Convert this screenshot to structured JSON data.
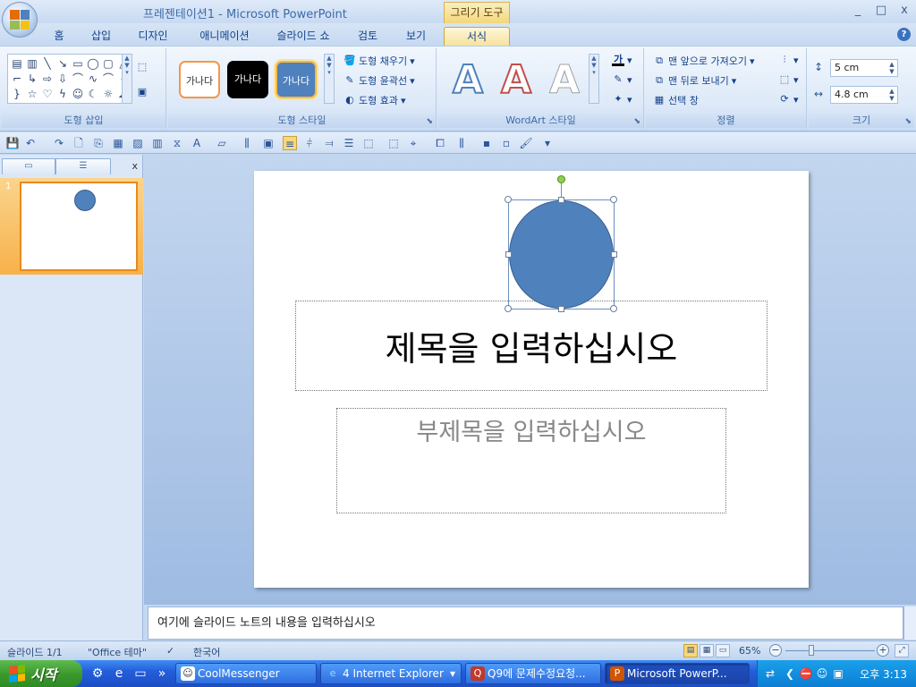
{
  "window": {
    "title": "프레젠테이션1 - Microsoft PowerPoint",
    "context_tab_title": "그리기 도구",
    "controls": [
      "_",
      "□",
      "x"
    ]
  },
  "tabs": [
    "홈",
    "삽입",
    "디자인",
    "애니메이션",
    "슬라이드 쇼",
    "검토",
    "보기",
    "서식"
  ],
  "active_tab": "서식",
  "ribbon": {
    "groups": {
      "insert_shapes": "도형 삽입",
      "shape_styles": "도형 스타일",
      "wordart_styles": "WordArt 스타일",
      "arrange": "정렬",
      "size": "크기"
    },
    "style_thumbs": [
      "가나다",
      "가나다",
      "가나다"
    ],
    "shape_fill": "도형 채우기",
    "shape_outline": "도형 윤곽선",
    "shape_effects": "도형 효과",
    "wordart_letters": [
      "A",
      "A",
      "A"
    ],
    "text_fill_glyph": "가",
    "bring_to_front": "맨 앞으로 가져오기",
    "send_to_back": "맨 뒤로 보내기",
    "selection_pane": "선택 창",
    "height_value": "5 cm",
    "width_value": "4.8 cm"
  },
  "slide": {
    "title_placeholder": "제목을 입력하십시오",
    "subtitle_placeholder": "부제목을 입력하십시오",
    "shape_color": "#4f81bd",
    "shape_outline_color": "#385d8a"
  },
  "thumbnail": {
    "number": "1"
  },
  "notes": {
    "placeholder": "여기에 슬라이드 노트의 내용을 입력하십시오"
  },
  "status": {
    "slide_index": "슬라이드 1/1",
    "theme": "\"Office 테마\"",
    "language": "한국어",
    "zoom": "65%"
  },
  "taskbar": {
    "start_label": "시작",
    "buttons": [
      "CoolMessenger",
      "4 Internet Explorer",
      "Q9에 문제수정요청...",
      "Microsoft PowerP..."
    ],
    "clock": "오후 3:13"
  }
}
